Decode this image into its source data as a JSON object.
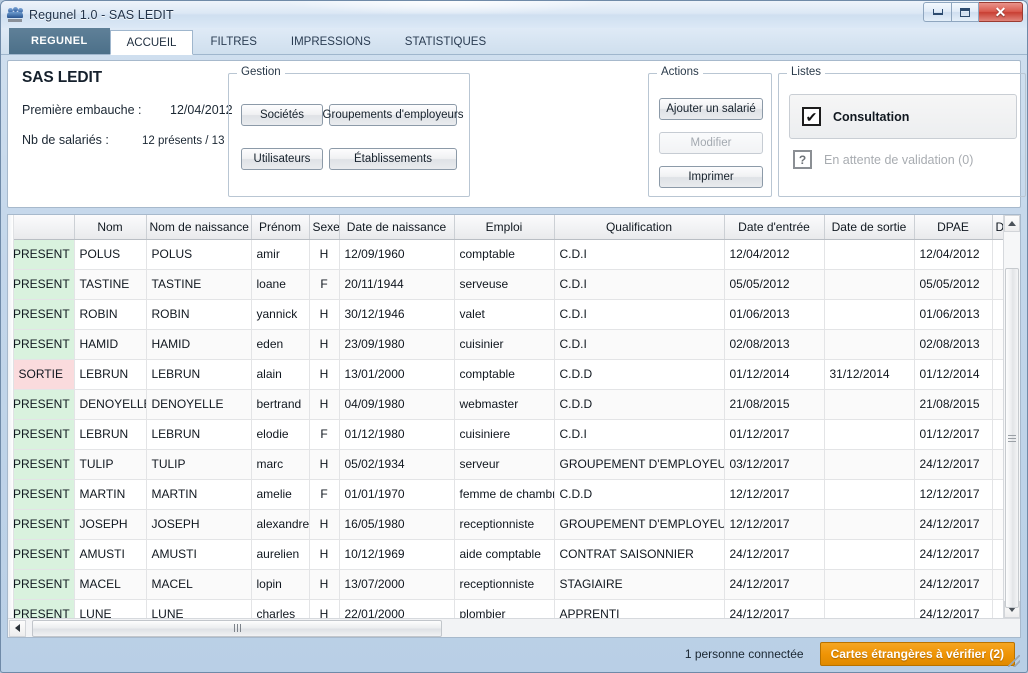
{
  "window": {
    "title": "Regunel 1.0 - SAS LEDIT",
    "app_icon": "people-icon",
    "buttons": {
      "minimize": "minimize-icon",
      "maximize": "maximize-icon",
      "close": "✕"
    }
  },
  "tabs": [
    {
      "label": "REGUNEL",
      "kind": "brand"
    },
    {
      "label": "ACCUEIL",
      "kind": "active"
    },
    {
      "label": "FILTRES",
      "kind": "normal"
    },
    {
      "label": "IMPRESSIONS",
      "kind": "normal"
    },
    {
      "label": "STATISTIQUES",
      "kind": "normal"
    }
  ],
  "info": {
    "company": "SAS LEDIT",
    "first_hire_label": "Première embauche :",
    "first_hire_value": "12/04/2012",
    "employee_count_label": "Nb de salariés :",
    "employee_count_value": "12 présents / 13"
  },
  "gestion": {
    "title": "Gestion",
    "societes": "Sociétés",
    "groupements": "Groupements d'employeurs",
    "utilisateurs": "Utilisateurs",
    "etablissements": "Établissements"
  },
  "actions": {
    "title": "Actions",
    "ajouter": "Ajouter un salarié",
    "modifier": "Modifier",
    "imprimer": "Imprimer"
  },
  "listes": {
    "title": "Listes",
    "consultation": "Consultation",
    "consultation_check": "✔",
    "pending": "En attente de validation (0)",
    "pending_mark": "?"
  },
  "grid": {
    "columns": [
      "",
      "Nom",
      "Nom de naissance",
      "Prénom",
      "Sexe",
      "Date de naissance",
      "Emploi",
      "Qualification",
      "Date d'entrée",
      "Date de sortie",
      "DPAE",
      "Dat"
    ],
    "rows": [
      {
        "status": "PRESENT",
        "nom": "POLUS",
        "nom_naissance": "POLUS",
        "prenom": "amir",
        "sexe": "H",
        "date_naissance": "12/09/1960",
        "emploi": "comptable",
        "qualification": "C.D.I",
        "date_entree": "12/04/2012",
        "date_sortie": "",
        "dpae": "12/04/2012",
        "dat": ""
      },
      {
        "status": "PRESENT",
        "nom": "TASTINE",
        "nom_naissance": "TASTINE",
        "prenom": "loane",
        "sexe": "F",
        "date_naissance": "20/11/1944",
        "emploi": "serveuse",
        "qualification": "C.D.I",
        "date_entree": "05/05/2012",
        "date_sortie": "",
        "dpae": "05/05/2012",
        "dat": ""
      },
      {
        "status": "PRESENT",
        "nom": "ROBIN",
        "nom_naissance": "ROBIN",
        "prenom": "yannick",
        "sexe": "H",
        "date_naissance": "30/12/1946",
        "emploi": "valet",
        "qualification": "C.D.I",
        "date_entree": "01/06/2013",
        "date_sortie": "",
        "dpae": "01/06/2013",
        "dat": ""
      },
      {
        "status": "PRESENT",
        "nom": "HAMID",
        "nom_naissance": "HAMID",
        "prenom": "eden",
        "sexe": "H",
        "date_naissance": "23/09/1980",
        "emploi": "cuisinier",
        "qualification": "C.D.I",
        "date_entree": "02/08/2013",
        "date_sortie": "",
        "dpae": "02/08/2013",
        "dat": ""
      },
      {
        "status": "SORTIE",
        "nom": "LEBRUN",
        "nom_naissance": "LEBRUN",
        "prenom": "alain",
        "sexe": "H",
        "date_naissance": "13/01/2000",
        "emploi": "comptable",
        "qualification": "C.D.D",
        "date_entree": "01/12/2014",
        "date_sortie": "31/12/2014",
        "dpae": "01/12/2014",
        "dat": ""
      },
      {
        "status": "PRESENT",
        "nom": "DENOYELLE",
        "nom_naissance": "DENOYELLE",
        "prenom": "bertrand",
        "sexe": "H",
        "date_naissance": "04/09/1980",
        "emploi": "webmaster",
        "qualification": "C.D.D",
        "date_entree": "21/08/2015",
        "date_sortie": "",
        "dpae": "21/08/2015",
        "dat": ""
      },
      {
        "status": "PRESENT",
        "nom": "LEBRUN",
        "nom_naissance": "LEBRUN",
        "prenom": "elodie",
        "sexe": "F",
        "date_naissance": "01/12/1980",
        "emploi": "cuisiniere",
        "qualification": "C.D.I",
        "date_entree": "01/12/2017",
        "date_sortie": "",
        "dpae": "01/12/2017",
        "dat": ""
      },
      {
        "status": "PRESENT",
        "nom": "TULIP",
        "nom_naissance": "TULIP",
        "prenom": "marc",
        "sexe": "H",
        "date_naissance": "05/02/1934",
        "emploi": "serveur",
        "qualification": "GROUPEMENT D'EMPLOYEUR",
        "date_entree": "03/12/2017",
        "date_sortie": "",
        "dpae": "24/12/2017",
        "dat": ""
      },
      {
        "status": "PRESENT",
        "nom": "MARTIN",
        "nom_naissance": "MARTIN",
        "prenom": "amelie",
        "sexe": "F",
        "date_naissance": "01/01/1970",
        "emploi": "femme de chambre",
        "qualification": "C.D.D",
        "date_entree": "12/12/2017",
        "date_sortie": "",
        "dpae": "12/12/2017",
        "dat": ""
      },
      {
        "status": "PRESENT",
        "nom": "JOSEPH",
        "nom_naissance": "JOSEPH",
        "prenom": "alexandre",
        "sexe": "H",
        "date_naissance": "16/05/1980",
        "emploi": "receptionniste",
        "qualification": "GROUPEMENT D'EMPLOYEUR",
        "date_entree": "12/12/2017",
        "date_sortie": "",
        "dpae": "24/12/2017",
        "dat": ""
      },
      {
        "status": "PRESENT",
        "nom": "AMUSTI",
        "nom_naissance": "AMUSTI",
        "prenom": "aurelien",
        "sexe": "H",
        "date_naissance": "10/12/1969",
        "emploi": "aide comptable",
        "qualification": "CONTRAT SAISONNIER",
        "date_entree": "24/12/2017",
        "date_sortie": "",
        "dpae": "24/12/2017",
        "dat": ""
      },
      {
        "status": "PRESENT",
        "nom": "MACEL",
        "nom_naissance": "MACEL",
        "prenom": "lopin",
        "sexe": "H",
        "date_naissance": "13/07/2000",
        "emploi": "receptionniste",
        "qualification": "STAGIAIRE",
        "date_entree": "24/12/2017",
        "date_sortie": "",
        "dpae": "24/12/2017",
        "dat": ""
      },
      {
        "status": "PRESENT",
        "nom": "LUNE",
        "nom_naissance": "LUNE",
        "prenom": "charles",
        "sexe": "H",
        "date_naissance": "22/01/2000",
        "emploi": "plombier",
        "qualification": "APPRENTI",
        "date_entree": "24/12/2017",
        "date_sortie": "",
        "dpae": "24/12/2017",
        "dat": ""
      }
    ]
  },
  "statusbar": {
    "connected": "1 personne connectée",
    "warning_badge": "Cartes étrangères à vérifier (2)"
  },
  "colors": {
    "brand_tab": "#4c7089",
    "present_row": "#d9f2de",
    "sortie_row": "#fadbdd",
    "warning": "#ef9405"
  }
}
